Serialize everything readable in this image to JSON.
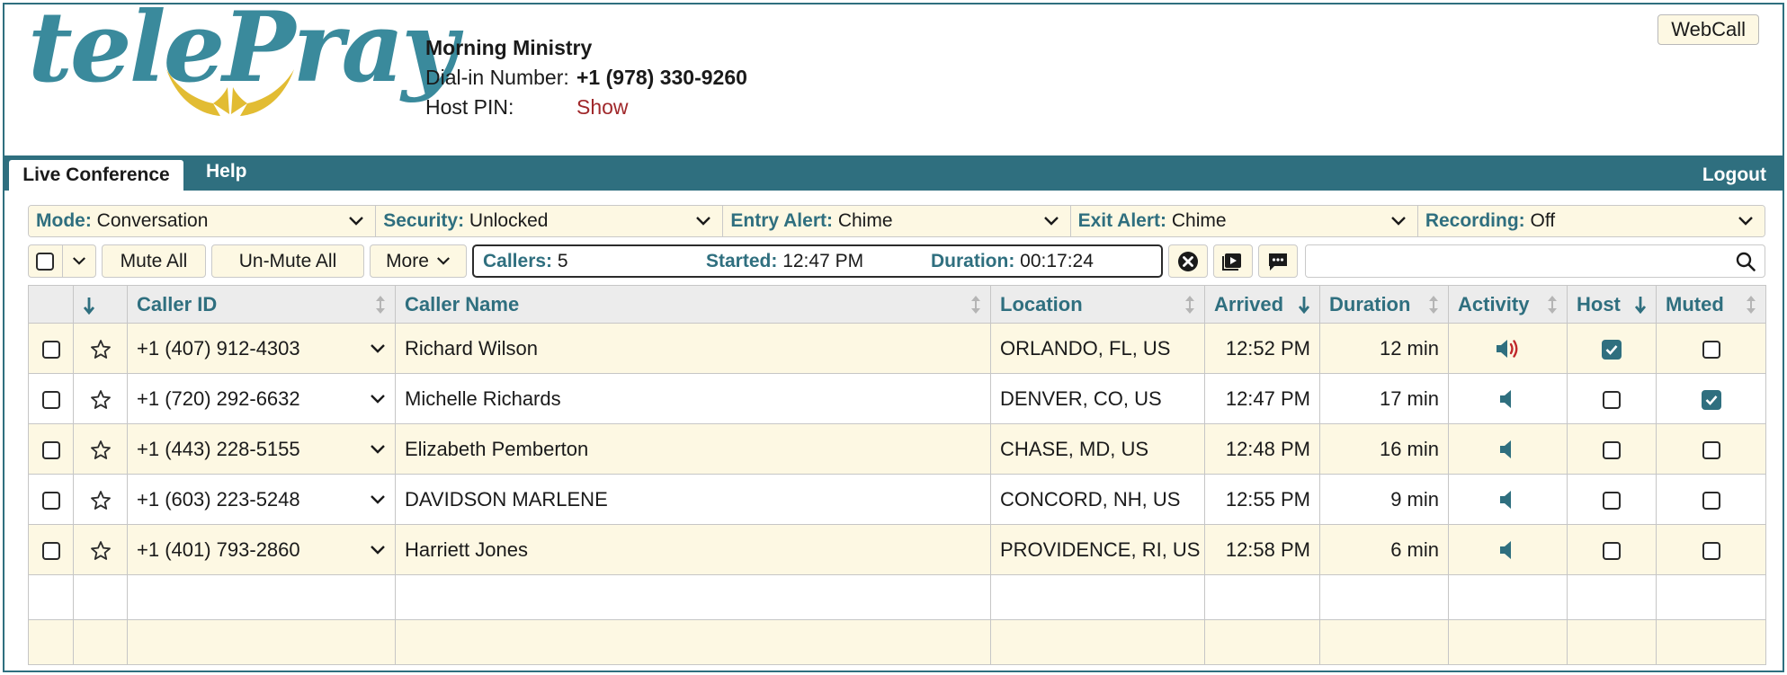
{
  "brand": {
    "logo_text": "telePray"
  },
  "conference": {
    "title": "Morning Ministry",
    "dial_label": "Dial-in Number:",
    "dial_number": "+1 (978) 330-9260",
    "pin_label": "Host PIN:",
    "pin_action": "Show"
  },
  "webcall_label": "WebCall",
  "nav": {
    "tabs": [
      {
        "label": "Live Conference",
        "active": true
      },
      {
        "label": "Help",
        "active": false
      }
    ],
    "logout": "Logout"
  },
  "modes": [
    {
      "key": "Mode:",
      "value": "Conversation"
    },
    {
      "key": "Security:",
      "value": "Unlocked"
    },
    {
      "key": "Entry Alert:",
      "value": "Chime"
    },
    {
      "key": "Exit Alert:",
      "value": "Chime"
    },
    {
      "key": "Recording:",
      "value": "Off"
    }
  ],
  "toolbar": {
    "mute_all": "Mute All",
    "unmute_all": "Un-Mute All",
    "more": "More",
    "callers_label": "Callers:",
    "callers_value": "5",
    "started_label": "Started:",
    "started_value": "12:47 PM",
    "duration_label": "Duration:",
    "duration_value": "00:17:24",
    "search_value": ""
  },
  "table": {
    "columns": [
      "Caller ID",
      "Caller Name",
      "Location",
      "Arrived",
      "Duration",
      "Activity",
      "Host",
      "Muted"
    ],
    "rows": [
      {
        "caller_id": "+1 (407) 912-4303",
        "name": "Richard Wilson",
        "location": "ORLANDO, FL, US",
        "arrived": "12:52 PM",
        "duration": "12 min",
        "speaking": true,
        "host": true,
        "muted": false
      },
      {
        "caller_id": "+1 (720) 292-6632",
        "name": "Michelle Richards",
        "location": "DENVER, CO, US",
        "arrived": "12:47 PM",
        "duration": "17 min",
        "speaking": false,
        "host": false,
        "muted": true
      },
      {
        "caller_id": "+1 (443) 228-5155",
        "name": "Elizabeth Pemberton",
        "location": "CHASE, MD, US",
        "arrived": "12:48 PM",
        "duration": "16 min",
        "speaking": false,
        "host": false,
        "muted": false
      },
      {
        "caller_id": "+1 (603) 223-5248",
        "name": "DAVIDSON MARLENE",
        "location": "CONCORD, NH, US",
        "arrived": "12:55 PM",
        "duration": "9 min",
        "speaking": false,
        "host": false,
        "muted": false
      },
      {
        "caller_id": "+1 (401) 793-2860",
        "name": "Harriett Jones",
        "location": "PROVIDENCE, RI, US",
        "arrived": "12:58 PM",
        "duration": "6 min",
        "speaking": false,
        "host": false,
        "muted": false
      }
    ]
  },
  "colors": {
    "accent": "#2f6f7f",
    "brand_teal": "#3a8a9c",
    "brand_gold": "#e2bc33",
    "row_tint": "#fdf8e3",
    "pin_link": "#a0282b",
    "speaking": "#c0282b"
  }
}
